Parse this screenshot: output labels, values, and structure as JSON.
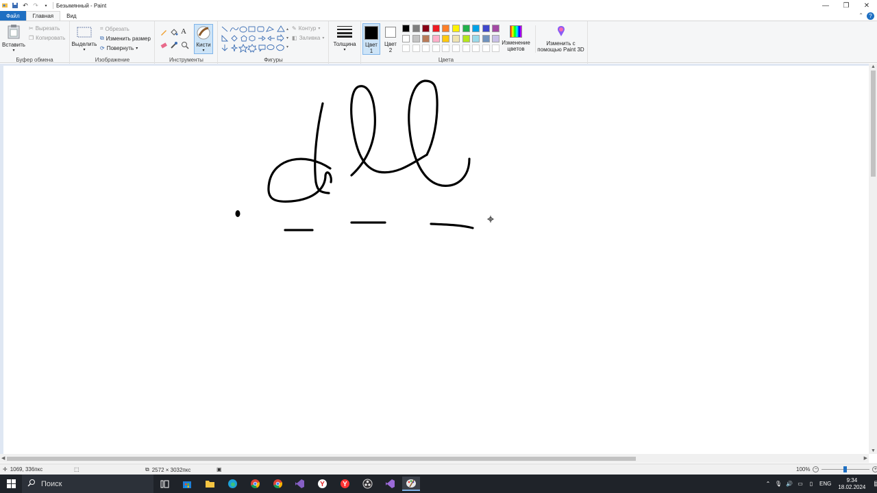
{
  "window": {
    "title": "Безымянный - Paint"
  },
  "menu": {
    "tabs": [
      "Файл",
      "Главная",
      "Вид"
    ]
  },
  "ribbon": {
    "clipboard": {
      "paste": "Вставить",
      "cut": "Вырезать",
      "copy": "Копировать",
      "label": "Буфер обмена"
    },
    "image": {
      "select": "Выделить",
      "crop": "Обрезать",
      "resize": "Изменить размер",
      "rotate": "Повернуть",
      "label": "Изображение"
    },
    "tools": {
      "label": "Инструменты",
      "brushes": "Кисти"
    },
    "shapes": {
      "outline": "Контур",
      "fill": "Заливка",
      "label": "Фигуры"
    },
    "size": {
      "label": "Толщина"
    },
    "colors": {
      "color1": "Цвет 1",
      "color2": "Цвет 2",
      "edit": "Изменение цветов",
      "paint3d": "Изменить с помощью Paint 3D",
      "label": "Цвета",
      "palette": [
        "#000000",
        "#7f7f7f",
        "#880015",
        "#ed1c24",
        "#ff7f27",
        "#fff200",
        "#22b14c",
        "#00a2e8",
        "#3f48cc",
        "#a349a4",
        "#ffffff",
        "#c3c3c3",
        "#b97a57",
        "#ffaec9",
        "#ffc90e",
        "#efe4b0",
        "#b5e61d",
        "#99d9ea",
        "#7092be",
        "#c8bfe7"
      ]
    }
  },
  "status": {
    "cursor_pos": "1069, 336пкс",
    "image_size": "2572 × 3032пкс",
    "zoom": "100%"
  },
  "taskbar": {
    "search_placeholder": "Поиск",
    "language": "ENG",
    "time": "9:34",
    "date": "18.02.2024"
  }
}
